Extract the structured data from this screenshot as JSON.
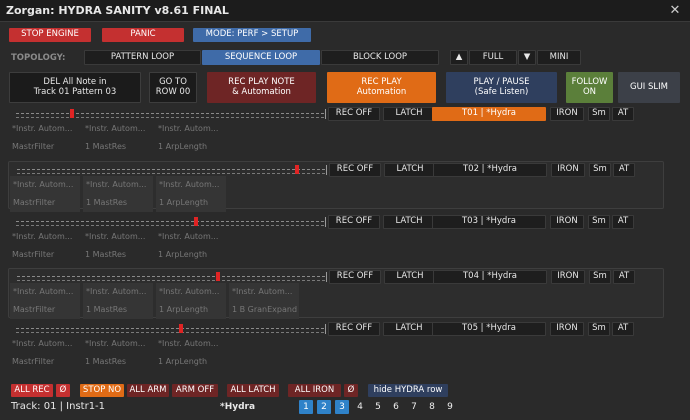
{
  "window": {
    "title": "Zorgan: HYDRA SANITY v8.61 FINAL",
    "close_glyph": "✕"
  },
  "toolbar": {
    "stop_engine": "STOP ENGINE",
    "panic": "PANIC",
    "mode": "MODE: PERF > SETUP"
  },
  "topology": {
    "label": "TOPOLOGY:",
    "pattern_loop": "PATTERN LOOP",
    "sequence_loop": "SEQUENCE LOOP",
    "block_loop": "BLOCK LOOP",
    "up_arrow": "▲",
    "full": "FULL",
    "down_arrow": "▼",
    "mini": "MINI"
  },
  "actions": {
    "del_all_line1": "DEL All Note in",
    "del_all_line2": "Track 01 Pattern 03",
    "goto_line1": "GO TO",
    "goto_line2": "ROW 00",
    "rec_play_note_line1": "REC PLAY NOTE",
    "rec_play_note_line2": "& Automation",
    "rec_play_line1": "REC PLAY",
    "rec_play_line2": "Automation",
    "play_pause_line1": "PLAY / PAUSE",
    "play_pause_line2": "(Safe Listen)",
    "follow_line1": "FOLLOW",
    "follow_line2": "ON",
    "gui_slim": "GUI SLIM"
  },
  "tracks": [
    {
      "rec": "REC OFF",
      "latch": "LATCH",
      "name": "T01 | *Hydra",
      "iron": "IRON",
      "sm": "Sm",
      "at": "AT",
      "slider_level": 0.18,
      "params": [
        {
          "a": "*Instr. Autom...",
          "b": "MastrFilter"
        },
        {
          "a": "*Instr. Autom...",
          "b": "1 MastRes"
        },
        {
          "a": "*Instr. Autom...",
          "b": "1 ArpLength"
        }
      ]
    },
    {
      "rec": "REC OFF",
      "latch": "LATCH",
      "name": "T02 | *Hydra",
      "iron": "IRON",
      "sm": "Sm",
      "at": "AT",
      "slider_level": 0.92,
      "params": [
        {
          "a": "*Instr. Autom...",
          "b": "MastrFilter"
        },
        {
          "a": "*Instr. Autom...",
          "b": "1 MastRes"
        },
        {
          "a": "*Instr. Autom...",
          "b": "1 ArpLength"
        }
      ]
    },
    {
      "rec": "REC OFF",
      "latch": "LATCH",
      "name": "T03 | *Hydra",
      "iron": "IRON",
      "sm": "Sm",
      "at": "AT",
      "slider_level": 0.59,
      "params": [
        {
          "a": "*Instr. Autom...",
          "b": "MastrFilter"
        },
        {
          "a": "*Instr. Autom...",
          "b": "1 MastRes"
        },
        {
          "a": "*Instr. Autom...",
          "b": "1 ArpLength"
        }
      ]
    },
    {
      "rec": "REC OFF",
      "latch": "LATCH",
      "name": "T04 | *Hydra",
      "iron": "IRON",
      "sm": "Sm",
      "at": "AT",
      "slider_level": 0.66,
      "params": [
        {
          "a": "*Instr. Autom...",
          "b": "MastrFilter"
        },
        {
          "a": "*Instr. Autom...",
          "b": "1 MastRes"
        },
        {
          "a": "*Instr. Autom...",
          "b": "1 ArpLength"
        },
        {
          "a": "*Instr. Autom...",
          "b": "1 B GranExpand"
        }
      ]
    },
    {
      "rec": "REC OFF",
      "latch": "LATCH",
      "name": "T05 | *Hydra",
      "iron": "IRON",
      "sm": "Sm",
      "at": "AT",
      "slider_level": 0.54,
      "params": [
        {
          "a": "*Instr. Autom...",
          "b": "MastrFilter"
        },
        {
          "a": "*Instr. Autom...",
          "b": "1 MastRes"
        },
        {
          "a": "*Instr. Autom...",
          "b": "1 ArpLength"
        }
      ]
    }
  ],
  "footer": {
    "all_rec": "ALL REC",
    "zero1": "Ø",
    "stop_no": "STOP NO",
    "all_arm": "ALL ARM",
    "arm_off": "ARM OFF",
    "all_latch": "ALL LATCH",
    "all_iron": "ALL IRON",
    "zero2": "Ø",
    "hide_hydra_row": "hide HYDRA row",
    "track_info": "Track: 01 | Instr1-1",
    "hydra": "*Hydra",
    "pages": [
      "1",
      "2",
      "3",
      "4",
      "5",
      "6",
      "7",
      "8",
      "9"
    ],
    "active_pages": [
      "1",
      "2",
      "3"
    ]
  },
  "colors": {
    "red": "#c43030",
    "blue": "#3f6ba8",
    "orange": "#e06b16",
    "green": "#5b7f3a",
    "maroon": "#6e2525",
    "cyan": "#2f82c9"
  }
}
